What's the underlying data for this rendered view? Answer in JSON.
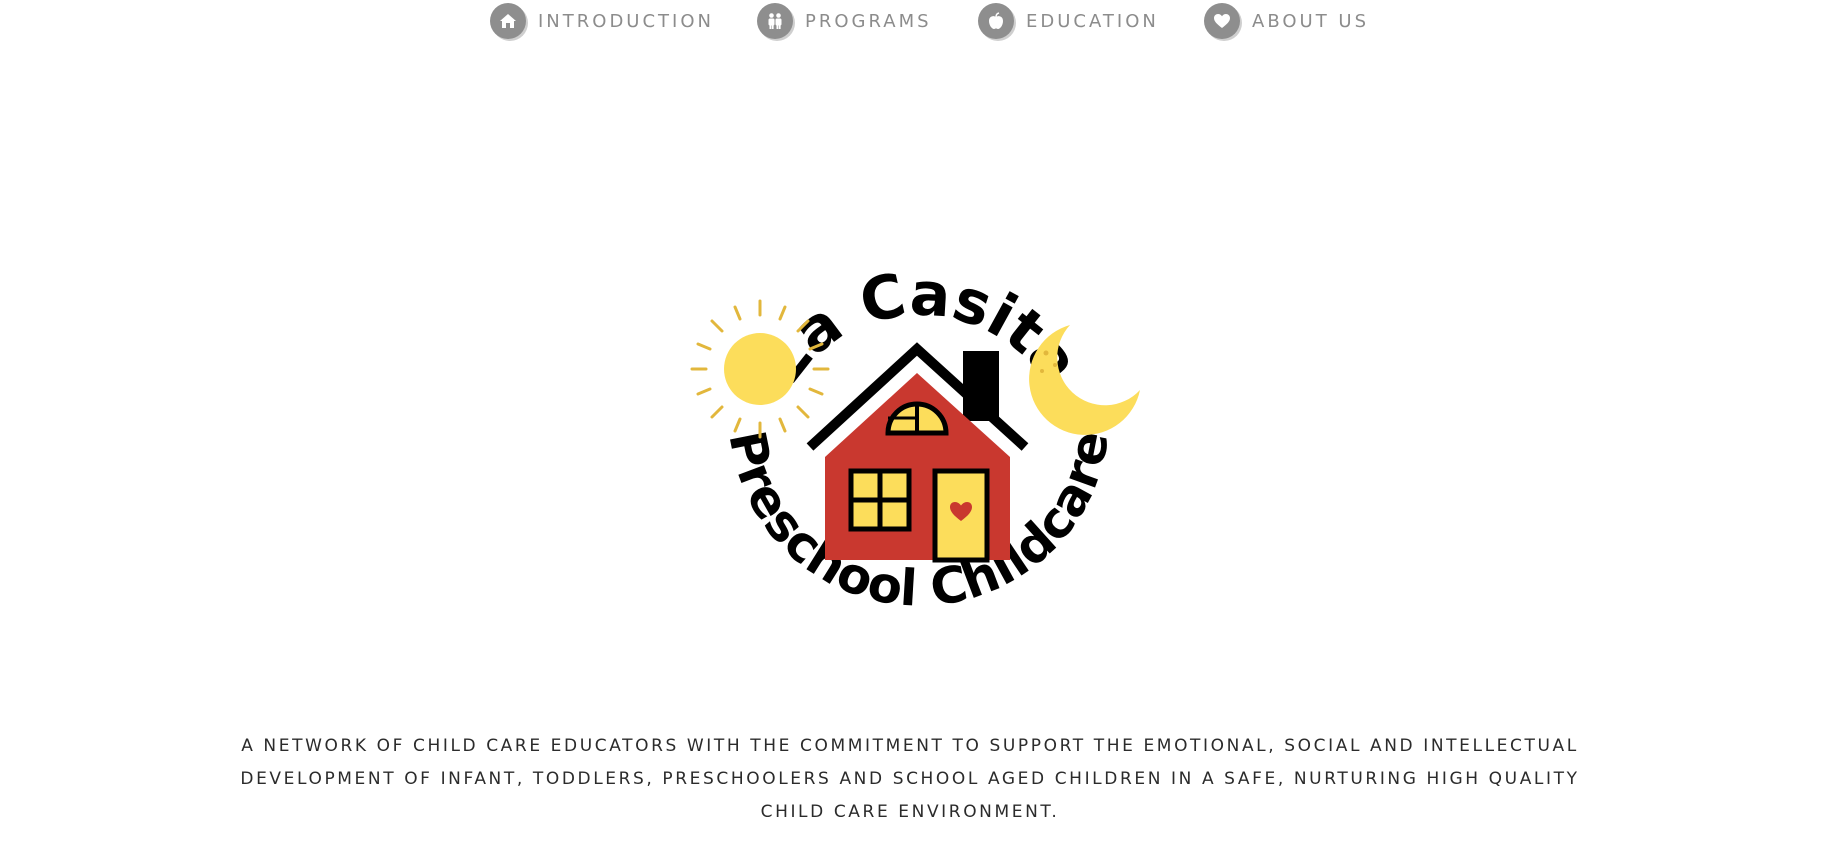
{
  "nav": {
    "items": [
      {
        "label": "INTRODUCTION",
        "icon": "home-icon"
      },
      {
        "label": "PROGRAMS",
        "icon": "children-icon"
      },
      {
        "label": "EDUCATION",
        "icon": "apple-icon"
      },
      {
        "label": "ABOUT US",
        "icon": "heart-icon"
      }
    ]
  },
  "logo": {
    "top_text": "La Casita",
    "bottom_text": "Preschool Childcare",
    "elements": [
      "sun",
      "house",
      "crescent-moon"
    ]
  },
  "tagline": "A NETWORK OF CHILD CARE EDUCATORS WITH THE COMMITMENT TO SUPPORT THE EMOTIONAL, SOCIAL AND INTELLECTUAL DEVELOPMENT OF INFANT, TODDLERS, PRESCHOOLERS AND SCHOOL AGED CHILDREN IN A SAFE, NURTURING HIGH QUALITY CHILD CARE ENVIRONMENT.",
  "colors": {
    "nav_icon_bg": "#8e8e8e",
    "nav_text": "#8c8c8c",
    "house_red": "#c9382f",
    "yellow": "#fcdd5b",
    "sun_rays": "#e2b73c",
    "outline": "#000000"
  }
}
